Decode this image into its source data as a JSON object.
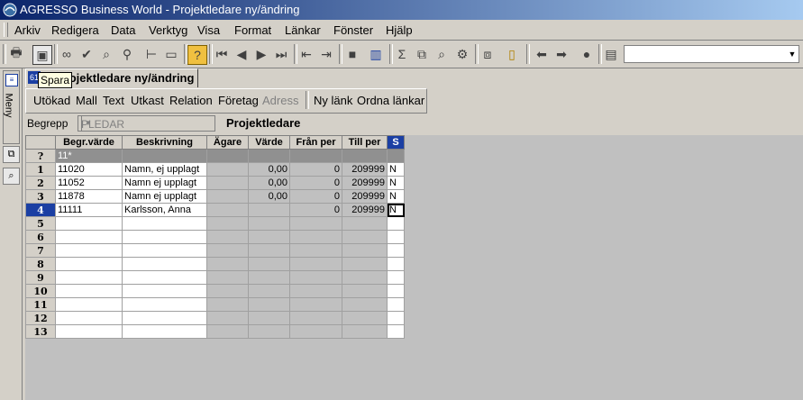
{
  "window": {
    "title": "AGRESSO Business World - Projektledare ny/ändring"
  },
  "menu": [
    "Arkiv",
    "Redigera",
    "Data",
    "Verktyg",
    "Visa",
    "Format",
    "Länkar",
    "Fönster",
    "Hjälp"
  ],
  "toolbar": {
    "icons": [
      "print-icon",
      "save-icon",
      "find-icon",
      "check-icon",
      "zoom-icon",
      "filter-icon",
      "tree-icon",
      "blank-icon",
      "help-icon",
      "first-icon",
      "prev-icon",
      "next-icon",
      "last-icon",
      "split-icon",
      "merge-icon",
      "stop-icon",
      "chart-icon",
      "sum-icon",
      "copy-icon",
      "search-icon",
      "workflow-icon",
      "window-icon",
      "report-icon",
      "back-icon",
      "forward-icon",
      "record-icon",
      "document-icon"
    ],
    "combo_value": ""
  },
  "sidebar": {
    "meny_label": "Meny"
  },
  "tab": {
    "label": "Projektledare ny/ändring",
    "icon_glyph": "61"
  },
  "tooltip": {
    "text": "Spara"
  },
  "subtoolbar": {
    "items": [
      "Utökad",
      "Mall",
      "Text",
      "Utkast",
      "Relation",
      "Företag",
      "Adress"
    ],
    "links": [
      "Ny länk",
      "Ordna länkar"
    ]
  },
  "form": {
    "begrepp_label": "Begrepp",
    "begrepp_value": "PLEDAR",
    "begrepp_title": "Projektledare"
  },
  "grid": {
    "headers": [
      "Begr.värde",
      "Beskrivning",
      "Ägare",
      "Värde",
      "Från per",
      "Till per",
      "S"
    ],
    "filter_row": {
      "rownum": "?",
      "begr": "11*"
    },
    "rows": [
      {
        "rownum": "1",
        "begr": "11020",
        "beskr": "Namn, ej upplagt",
        "agare": "",
        "varde": "0,00",
        "fran": "0",
        "till": "209999",
        "s": "N"
      },
      {
        "rownum": "2",
        "begr": "11052",
        "beskr": "Namn ej upplagt",
        "agare": "",
        "varde": "0,00",
        "fran": "0",
        "till": "209999",
        "s": "N"
      },
      {
        "rownum": "3",
        "begr": "11878",
        "beskr": "Namn ej upplagt",
        "agare": "",
        "varde": "0,00",
        "fran": "0",
        "till": "209999",
        "s": "N"
      },
      {
        "rownum": "4",
        "begr": "11111",
        "beskr": "Karlsson, Anna",
        "agare": "",
        "varde": "",
        "fran": "0",
        "till": "209999",
        "s": "N"
      },
      {
        "rownum": "5"
      },
      {
        "rownum": "6"
      },
      {
        "rownum": "7"
      },
      {
        "rownum": "8"
      },
      {
        "rownum": "9"
      },
      {
        "rownum": "10"
      },
      {
        "rownum": "11"
      },
      {
        "rownum": "12"
      },
      {
        "rownum": "13"
      }
    ],
    "active_row": "4"
  }
}
